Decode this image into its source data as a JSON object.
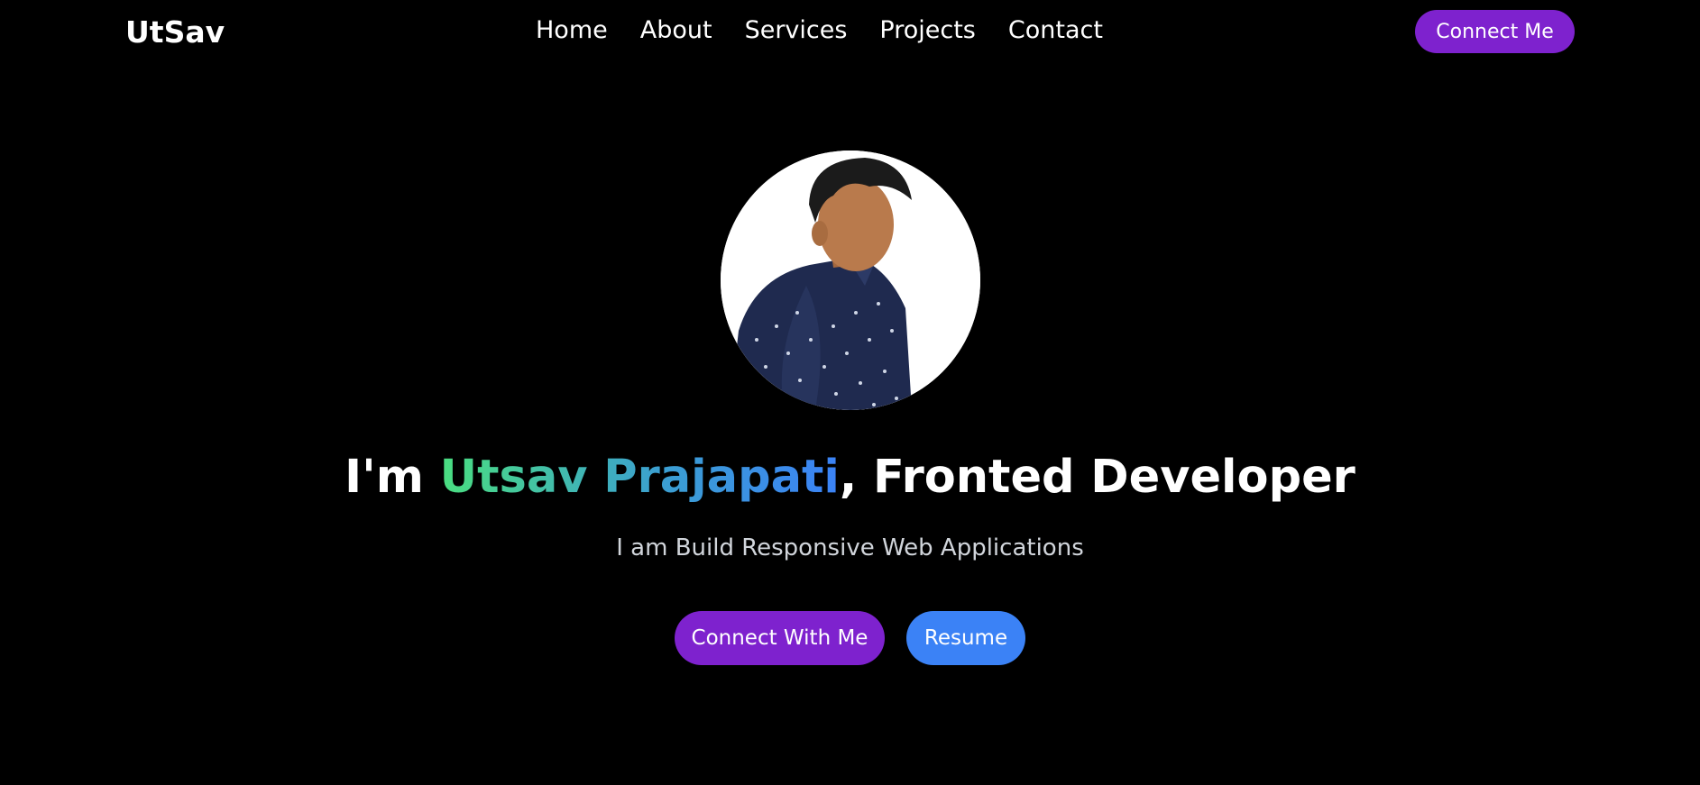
{
  "nav": {
    "logo": "UtSav",
    "links": [
      "Home",
      "About",
      "Services",
      "Projects",
      "Contact"
    ],
    "cta_label": "Connect Me"
  },
  "hero": {
    "headline_prefix": "I'm ",
    "headline_name": "Utsav Prajapati",
    "headline_suffix": ", Fronted Developer",
    "subtitle": "I am Build Responsive Web Applications",
    "primary_button": "Connect With Me",
    "secondary_button": "Resume"
  },
  "colors": {
    "background": "#000000",
    "accent_purple": "#7e22ce",
    "accent_blue": "#3b82f6",
    "gradient_start": "#4ade80",
    "gradient_end": "#3b82f6"
  }
}
